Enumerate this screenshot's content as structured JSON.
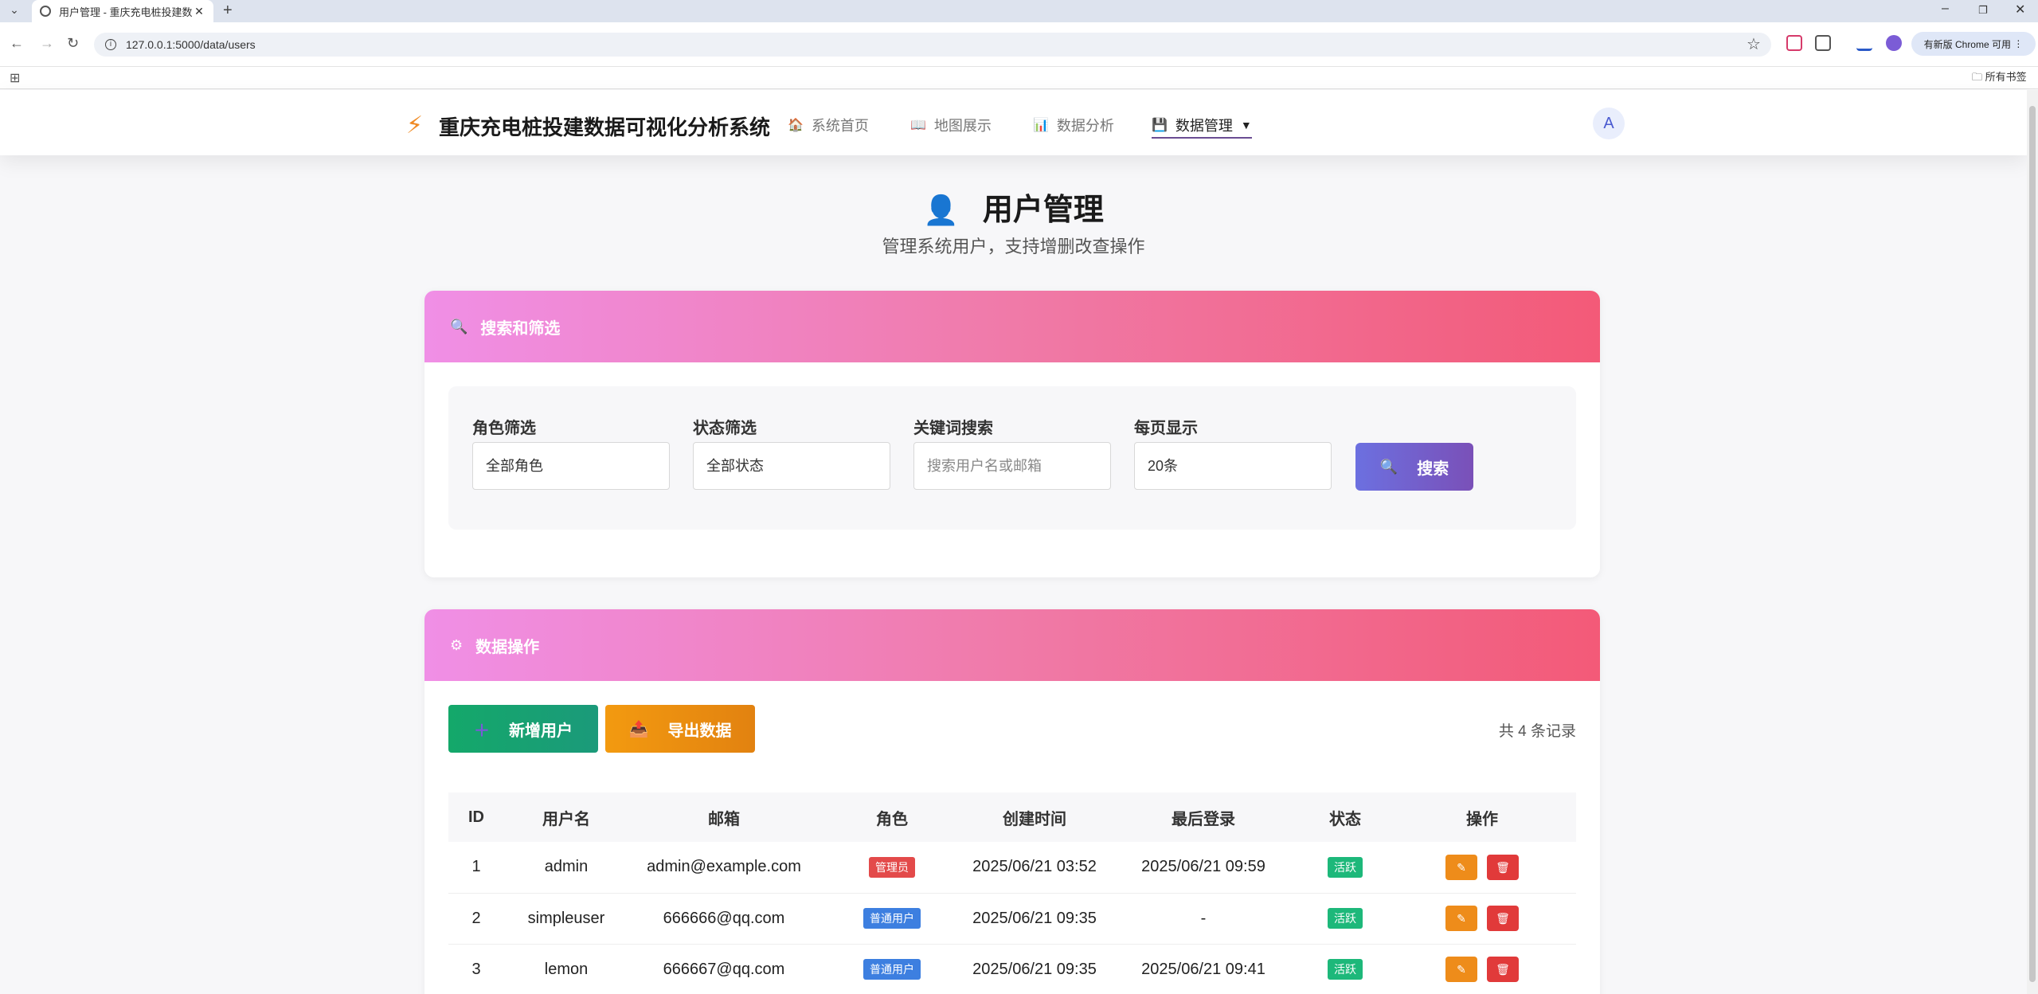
{
  "browser": {
    "tab_title": "用户管理 - 重庆充电桩投建数据",
    "url": "127.0.0.1:5000/data/users",
    "update_label": "有新版 Chrome 可用",
    "bookmarks_label": "所有书签"
  },
  "header": {
    "brand": "重庆充电桩投建数据可视化分析系统",
    "nav": [
      {
        "label": "系统首页",
        "icon": "home-icon"
      },
      {
        "label": "地图展示",
        "icon": "map-icon"
      },
      {
        "label": "数据分析",
        "icon": "chart-icon"
      },
      {
        "label": "数据管理",
        "icon": "database-icon"
      }
    ],
    "avatar_letter": "A"
  },
  "page": {
    "title": "用户管理",
    "subtitle": "管理系统用户，支持增删改查操作"
  },
  "filter_card": {
    "title": "搜索和筛选",
    "role_label": "角色筛选",
    "role_value": "全部角色",
    "status_label": "状态筛选",
    "status_value": "全部状态",
    "keyword_label": "关键词搜索",
    "keyword_placeholder": "搜索用户名或邮箱",
    "pagesize_label": "每页显示",
    "pagesize_value": "20条",
    "search_button": "搜索"
  },
  "data_card": {
    "title": "数据操作",
    "add_button": "新增用户",
    "export_button": "导出数据",
    "record_count": "共 4 条记录",
    "columns": [
      "ID",
      "用户名",
      "邮箱",
      "角色",
      "创建时间",
      "最后登录",
      "状态",
      "操作"
    ],
    "rows": [
      {
        "id": "1",
        "username": "admin",
        "email": "admin@example.com",
        "role": "管理员",
        "created": "2025/06/21 03:52",
        "last_login": "2025/06/21 09:59",
        "status": "活跃"
      },
      {
        "id": "2",
        "username": "simpleuser",
        "email": "666666@qq.com",
        "role": "普通用户",
        "created": "2025/06/21 09:35",
        "last_login": "-",
        "status": "活跃"
      },
      {
        "id": "3",
        "username": "lemon",
        "email": "666667@qq.com",
        "role": "普通用户",
        "created": "2025/06/21 09:35",
        "last_login": "2025/06/21 09:41",
        "status": "活跃"
      }
    ]
  },
  "colors": {
    "accent": "#6c70e0",
    "header_gradient_start": "#f08fe6",
    "header_gradient_end": "#f35a78",
    "add_button": "#17a870",
    "export_button": "#f0960f"
  }
}
